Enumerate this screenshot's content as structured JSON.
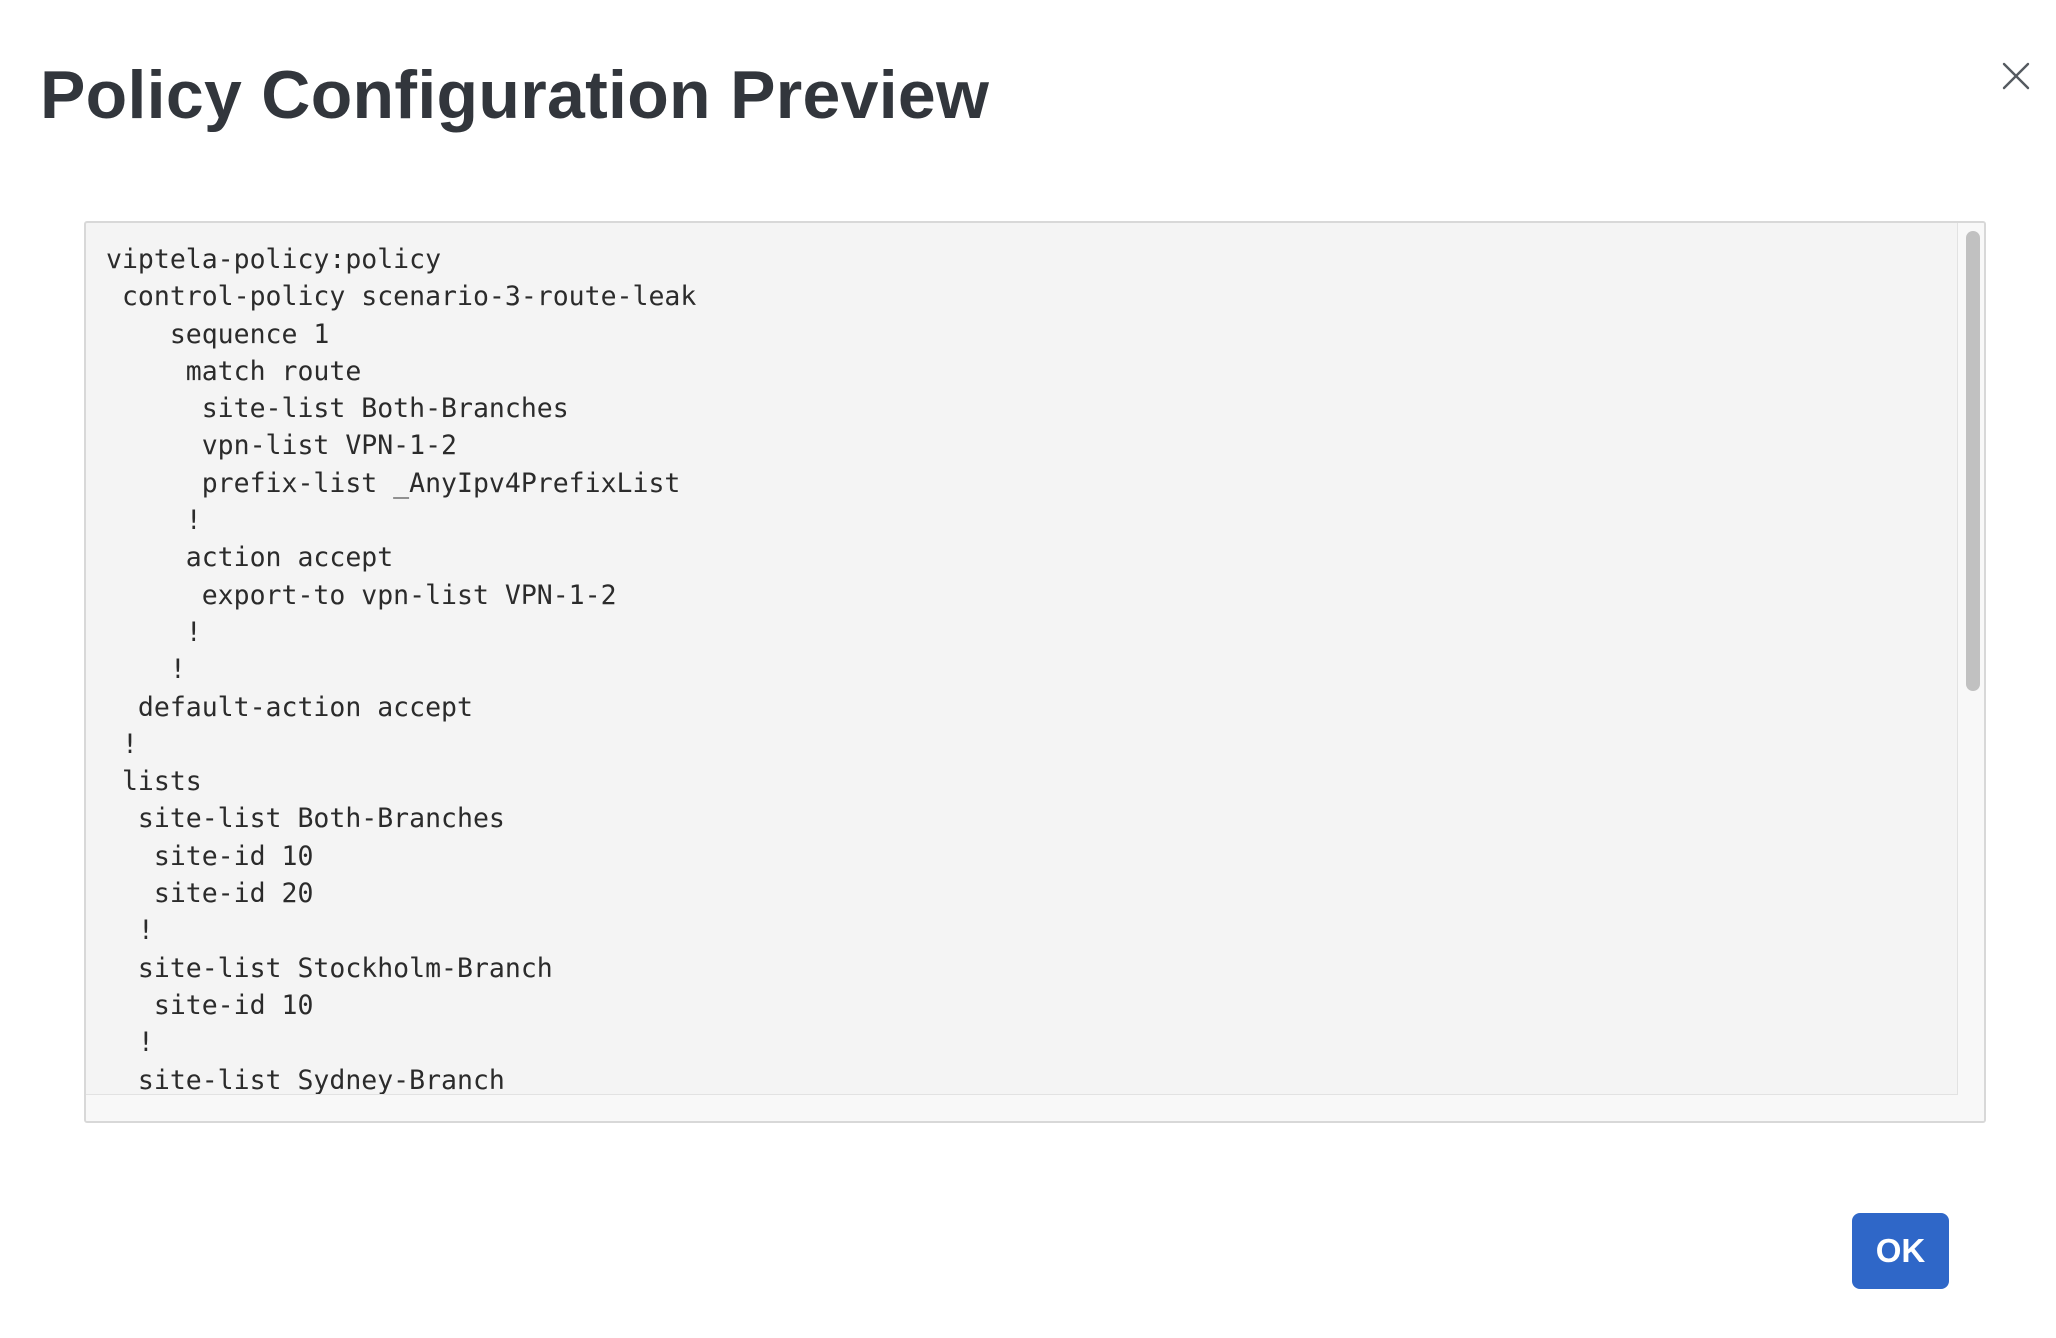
{
  "dialog": {
    "title": "Policy Configuration Preview",
    "ok_label": "OK",
    "accent_color": "#2f67c8"
  },
  "icons": {
    "close": "close-icon"
  },
  "code": {
    "text": "viptela-policy:policy\n control-policy scenario-3-route-leak\n    sequence 1\n     match route\n      site-list Both-Branches\n      vpn-list VPN-1-2\n      prefix-list _AnyIpv4PrefixList\n     !\n     action accept\n      export-to vpn-list VPN-1-2\n     !\n    !\n  default-action accept\n !\n lists\n  site-list Both-Branches\n   site-id 10\n   site-id 20\n  !\n  site-list Stockholm-Branch\n   site-id 10\n  !\n  site-list Sydney-Branch"
  }
}
